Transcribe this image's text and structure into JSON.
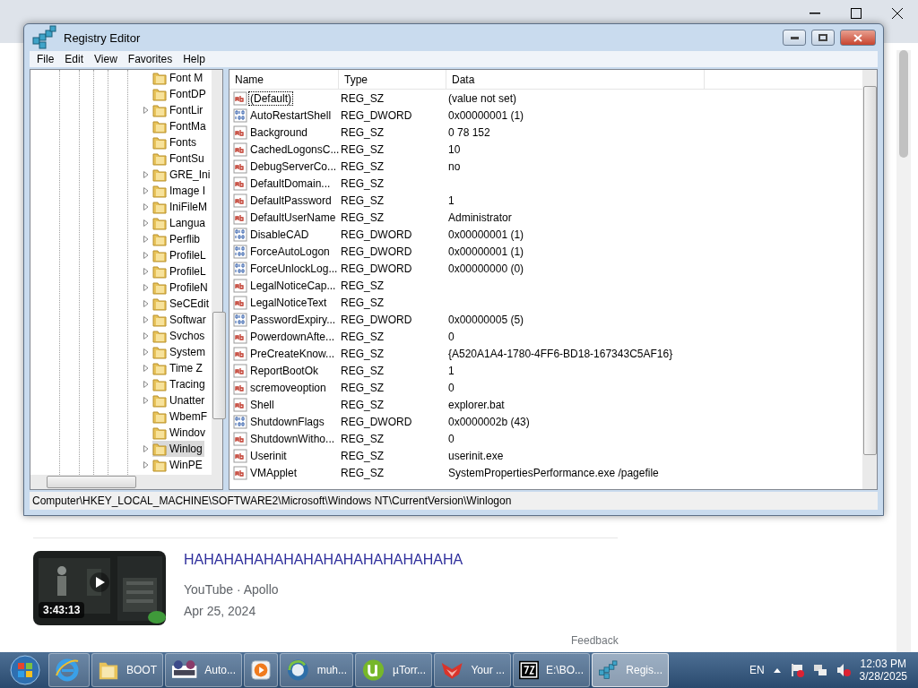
{
  "browser": {
    "feedback": "Feedback",
    "result": {
      "duration": "3:43:13",
      "title": "HAHAHAHAHAHAHAHAHAHAHAHAHAHA",
      "source": "YouTube · Apollo",
      "date": "Apr 25, 2024"
    }
  },
  "window": {
    "title": "Registry Editor"
  },
  "menu": [
    "File",
    "Edit",
    "View",
    "Favorites",
    "Help"
  ],
  "tree": [
    {
      "label": "Font M",
      "has_children": false,
      "selected": false
    },
    {
      "label": "FontDP",
      "has_children": false,
      "selected": false
    },
    {
      "label": "FontLir",
      "has_children": true,
      "selected": false
    },
    {
      "label": "FontMa",
      "has_children": false,
      "selected": false
    },
    {
      "label": "Fonts",
      "has_children": false,
      "selected": false
    },
    {
      "label": "FontSu",
      "has_children": false,
      "selected": false
    },
    {
      "label": "GRE_Ini",
      "has_children": true,
      "selected": false
    },
    {
      "label": "Image I",
      "has_children": true,
      "selected": false
    },
    {
      "label": "IniFileM",
      "has_children": true,
      "selected": false
    },
    {
      "label": "Langua",
      "has_children": true,
      "selected": false
    },
    {
      "label": "Perflib",
      "has_children": true,
      "selected": false
    },
    {
      "label": "ProfileL",
      "has_children": true,
      "selected": false
    },
    {
      "label": "ProfileL",
      "has_children": true,
      "selected": false
    },
    {
      "label": "ProfileN",
      "has_children": true,
      "selected": false
    },
    {
      "label": "SeCEdit",
      "has_children": true,
      "selected": false
    },
    {
      "label": "Softwar",
      "has_children": true,
      "selected": false
    },
    {
      "label": "Svchos",
      "has_children": true,
      "selected": false
    },
    {
      "label": "System",
      "has_children": true,
      "selected": false
    },
    {
      "label": "Time Z",
      "has_children": true,
      "selected": false
    },
    {
      "label": "Tracing",
      "has_children": true,
      "selected": false
    },
    {
      "label": "Unatter",
      "has_children": true,
      "selected": false
    },
    {
      "label": "WbemF",
      "has_children": false,
      "selected": false
    },
    {
      "label": "Windov",
      "has_children": false,
      "selected": false
    },
    {
      "label": "Winlog",
      "has_children": true,
      "selected": true
    },
    {
      "label": "WinPE",
      "has_children": true,
      "selected": false
    }
  ],
  "columns": [
    "Name",
    "Type",
    "Data"
  ],
  "values": [
    {
      "kind": "string",
      "name": "(Default)",
      "type": "REG_SZ",
      "data": "(value not set)",
      "focused": true
    },
    {
      "kind": "dword",
      "name": "AutoRestartShell",
      "type": "REG_DWORD",
      "data": "0x00000001 (1)",
      "focused": false
    },
    {
      "kind": "string",
      "name": "Background",
      "type": "REG_SZ",
      "data": "0 78 152",
      "focused": false
    },
    {
      "kind": "string",
      "name": "CachedLogonsC...",
      "type": "REG_SZ",
      "data": "10",
      "focused": false
    },
    {
      "kind": "string",
      "name": "DebugServerCo...",
      "type": "REG_SZ",
      "data": "no",
      "focused": false
    },
    {
      "kind": "string",
      "name": "DefaultDomain...",
      "type": "REG_SZ",
      "focused": false
    },
    {
      "kind": "string",
      "name": "DefaultPassword",
      "type": "REG_SZ",
      "data": "1",
      "focused": false
    },
    {
      "kind": "string",
      "name": "DefaultUserName",
      "type": "REG_SZ",
      "data": "Administrator",
      "focused": false
    },
    {
      "kind": "dword",
      "name": "DisableCAD",
      "type": "REG_DWORD",
      "data": "0x00000001 (1)",
      "focused": false
    },
    {
      "kind": "dword",
      "name": "ForceAutoLogon",
      "type": "REG_DWORD",
      "data": "0x00000001 (1)",
      "focused": false
    },
    {
      "kind": "dword",
      "name": "ForceUnlockLog...",
      "type": "REG_DWORD",
      "data": "0x00000000 (0)",
      "focused": false
    },
    {
      "kind": "string",
      "name": "LegalNoticeCap...",
      "type": "REG_SZ",
      "focused": false
    },
    {
      "kind": "string",
      "name": "LegalNoticeText",
      "type": "REG_SZ",
      "focused": false
    },
    {
      "kind": "dword",
      "name": "PasswordExpiry...",
      "type": "REG_DWORD",
      "data": "0x00000005 (5)",
      "focused": false
    },
    {
      "kind": "string",
      "name": "PowerdownAfte...",
      "type": "REG_SZ",
      "data": "0",
      "focused": false
    },
    {
      "kind": "string",
      "name": "PreCreateKnow...",
      "type": "REG_SZ",
      "data": "{A520A1A4-1780-4FF6-BD18-167343C5AF16}",
      "focused": false
    },
    {
      "kind": "string",
      "name": "ReportBootOk",
      "type": "REG_SZ",
      "data": "1",
      "focused": false
    },
    {
      "kind": "string",
      "name": "scremoveoption",
      "type": "REG_SZ",
      "data": "0",
      "focused": false
    },
    {
      "kind": "string",
      "name": "Shell",
      "type": "REG_SZ",
      "data": "explorer.bat",
      "focused": false
    },
    {
      "kind": "dword",
      "name": "ShutdownFlags",
      "type": "REG_DWORD",
      "data": "0x0000002b (43)",
      "focused": false
    },
    {
      "kind": "string",
      "name": "ShutdownWitho...",
      "type": "REG_SZ",
      "data": "0",
      "focused": false
    },
    {
      "kind": "string",
      "name": "Userinit",
      "type": "REG_SZ",
      "data": "userinit.exe",
      "focused": false
    },
    {
      "kind": "string",
      "name": "VMApplet",
      "type": "REG_SZ",
      "data": "SystemPropertiesPerformance.exe /pagefile",
      "focused": false
    }
  ],
  "status_bar": "Computer\\HKEY_LOCAL_MACHINE\\SOFTWARE2\\Microsoft\\Windows NT\\CurrentVersion\\Winlogon",
  "taskbar": {
    "items": [
      {
        "kind": "ie",
        "selected": false
      },
      {
        "kind": "folder",
        "label": "BOOT",
        "selected": false
      },
      {
        "kind": "app",
        "label": "Auto...",
        "selected": false
      },
      {
        "kind": "media",
        "selected": false
      },
      {
        "kind": "globe",
        "label": "muh...",
        "selected": false
      },
      {
        "kind": "torrent",
        "label": "µTorr...",
        "selected": false
      },
      {
        "kind": "fox",
        "label": "Your ...",
        "selected": false
      },
      {
        "kind": "zip",
        "label": "E:\\BO...",
        "selected": false
      },
      {
        "kind": "registry",
        "label": "Regis...",
        "selected": true
      }
    ],
    "language": "EN",
    "time": "12:03 PM",
    "date": "3/28/2025"
  }
}
